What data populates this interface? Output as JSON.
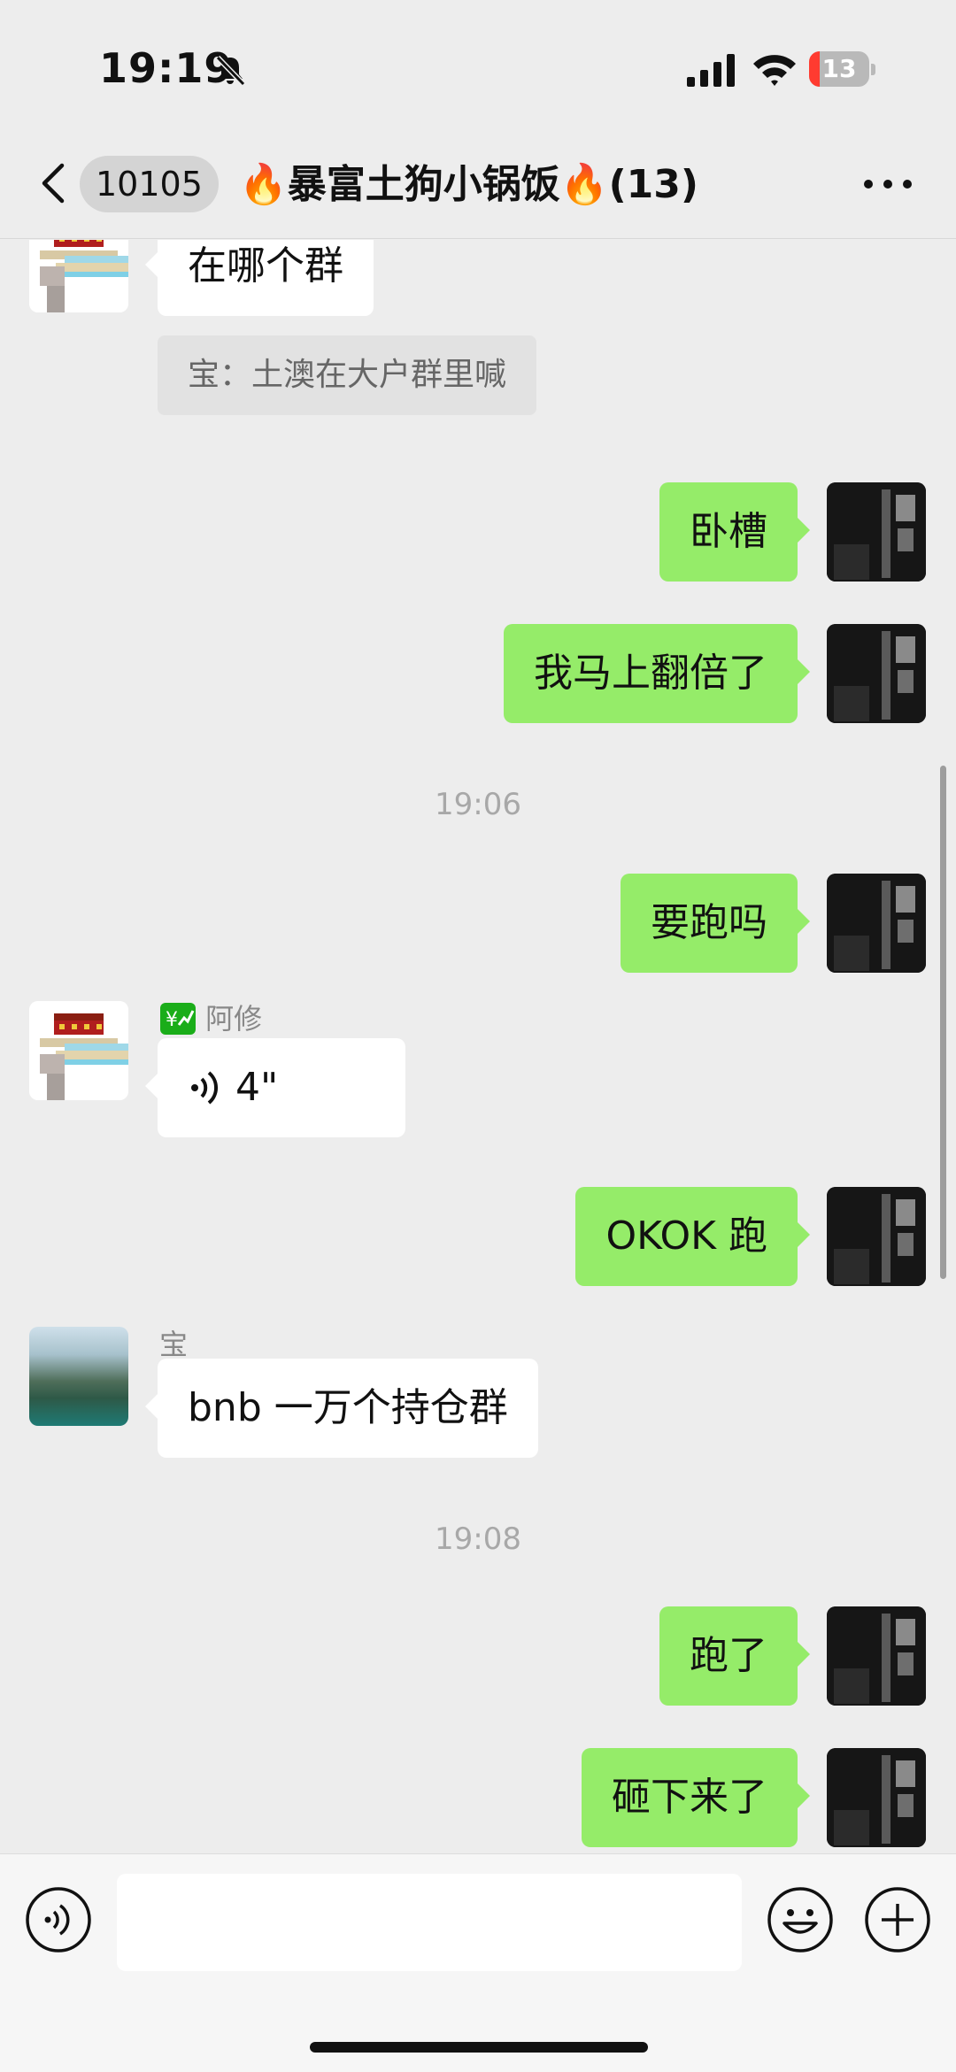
{
  "status_bar": {
    "time": "19:19",
    "battery_level": "13",
    "icons": [
      "bell-slash-icon",
      "cellular-signal-icon",
      "wifi-icon",
      "battery-icon"
    ]
  },
  "nav": {
    "unread_count": "10105",
    "title": "🔥暴富土狗小锅饭🔥(13)",
    "icons": [
      "chevron-left-icon",
      "ellipsis-icon"
    ]
  },
  "messages": [
    {
      "side": "left",
      "sender_truncated": "",
      "text": "在哪个群",
      "quote": "宝：土澳在大户群里喊"
    },
    {
      "side": "right",
      "text": "卧槽"
    },
    {
      "side": "right",
      "text": "我马上翻倍了"
    },
    {
      "type": "time",
      "text": "19:06"
    },
    {
      "side": "right",
      "text": "要跑吗"
    },
    {
      "side": "left",
      "sender": "阿修",
      "type": "voice",
      "duration": "4\""
    },
    {
      "side": "right",
      "text": "OKOK 跑"
    },
    {
      "side": "left",
      "sender": "宝",
      "text": "bnb 一万个持仓群"
    },
    {
      "type": "time",
      "text": "19:08"
    },
    {
      "side": "right",
      "text": "跑了"
    },
    {
      "side": "right",
      "text": "砸下来了"
    }
  ],
  "input_bar": {
    "placeholder": "",
    "icons": [
      "voice-icon",
      "emoji-icon",
      "plus-icon"
    ]
  },
  "colors": {
    "background": "#ededed",
    "self_bubble": "#95ec69",
    "other_bubble": "#ffffff",
    "battery_low": "#ff3b30"
  }
}
